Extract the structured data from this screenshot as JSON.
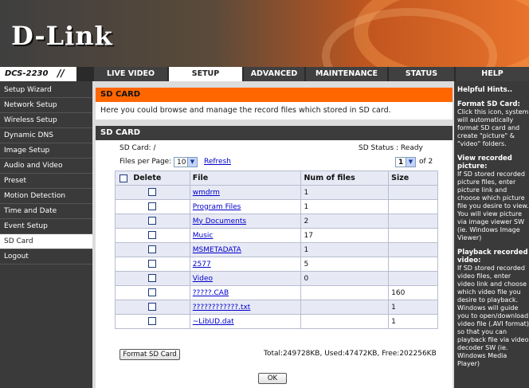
{
  "brand": {
    "logo": "D-Link",
    "model": "DCS-2230",
    "slashes": "//"
  },
  "nav": {
    "tabs": [
      "LIVE VIDEO",
      "SETUP",
      "ADVANCED",
      "MAINTENANCE",
      "STATUS",
      "HELP"
    ],
    "active": "SETUP"
  },
  "sidebar": {
    "items": [
      "Setup Wizard",
      "Network Setup",
      "Wireless Setup",
      "Dynamic DNS",
      "Image Setup",
      "Audio and Video",
      "Preset",
      "Motion Detection",
      "Time and Date",
      "Event Setup",
      "SD Card",
      "Logout"
    ],
    "active": "SD Card"
  },
  "main": {
    "header": "SD CARD",
    "description": "Here you could browse and manage the record files which stored in SD card.",
    "panel_header": "SD CARD",
    "sd_path_label": "SD Card: /",
    "sd_status": "SD Status : Ready",
    "files_per_page_label": "Files per Page:",
    "files_per_page_value": "10",
    "refresh_label": "Refresh",
    "page_value": "1",
    "page_of": "of 2",
    "columns": {
      "delete": "Delete",
      "file": "File",
      "num": "Num of files",
      "size": "Size"
    },
    "rows": [
      {
        "file": "wmdrm",
        "num": "1",
        "size": ""
      },
      {
        "file": "Program Files",
        "num": "1",
        "size": ""
      },
      {
        "file": "My Documents",
        "num": "2",
        "size": ""
      },
      {
        "file": "Music",
        "num": "17",
        "size": ""
      },
      {
        "file": "MSMETADATA",
        "num": "1",
        "size": ""
      },
      {
        "file": "2577",
        "num": "5",
        "size": ""
      },
      {
        "file": "Video",
        "num": "0",
        "size": ""
      },
      {
        "file": "?????.CAB",
        "num": "",
        "size": "160"
      },
      {
        "file": "????????????.txt",
        "num": "",
        "size": "1"
      },
      {
        "file": "~LibUD.dat",
        "num": "",
        "size": "1"
      }
    ],
    "format_button": "Format SD Card",
    "totals": "Total:249728KB, Used:47472KB, Free:202256KB",
    "ok_button": "OK"
  },
  "help": {
    "title": "Helpful Hints..",
    "sections": [
      {
        "title": "Format SD Card:",
        "body": "Click this icon, system will automatically format SD card and create \"picture\" & \"video\" folders."
      },
      {
        "title": "View recorded picture:",
        "body": "If SD stored recorded picture files, enter picture link and choose which picture file you desire to view. You will view picture via image viewer SW (ie. Windows Image Viewer)"
      },
      {
        "title": "Playback recorded video:",
        "body": "If SD stored recorded video files, enter video link and choose which video file you desire to playback. Windows will guide you to open/download video file (.AVI format) so that you can playback file via video decoder SW (ie. Windows Media Player)"
      }
    ]
  },
  "colors": {
    "accent": "#ff6600",
    "dark": "#3a3a3a",
    "link": "#0000cc"
  }
}
